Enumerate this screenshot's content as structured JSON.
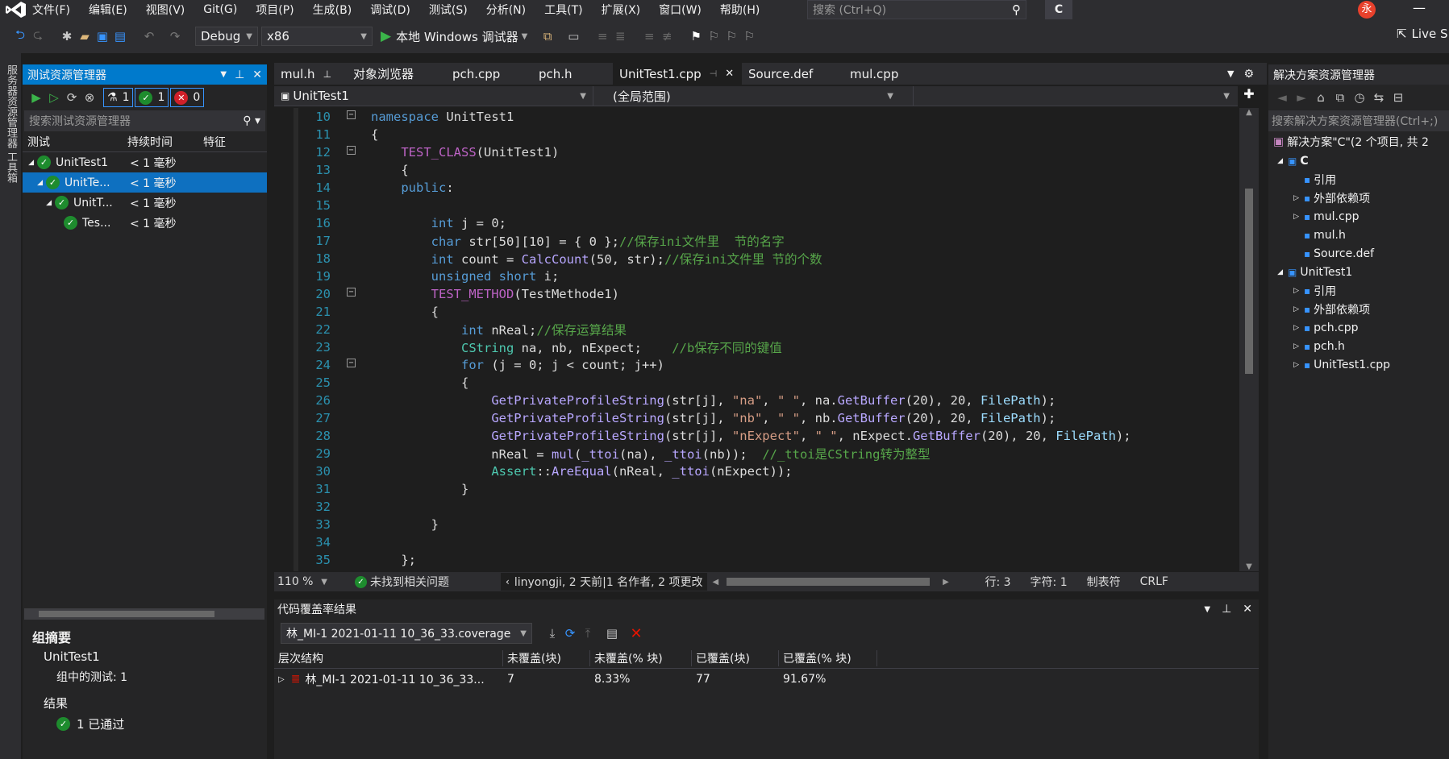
{
  "menu": [
    "文件(F)",
    "编辑(E)",
    "视图(V)",
    "Git(G)",
    "项目(P)",
    "生成(B)",
    "调试(D)",
    "测试(S)",
    "分析(N)",
    "工具(T)",
    "扩展(X)",
    "窗口(W)",
    "帮助(H)"
  ],
  "search_placeholder": "搜索 (Ctrl+Q)",
  "solution_short": "C",
  "user_initial": "永",
  "toolbar": {
    "config": "Debug",
    "platform": "x86",
    "run_label": "本地 Windows 调试器",
    "live_share": "Live S"
  },
  "side_strip": "服务器资源管理器  工具箱",
  "test_explorer": {
    "title": "测试资源管理器",
    "count_total": "1",
    "count_passed": "1",
    "count_failed": "0",
    "search_placeholder": "搜索测试资源管理器",
    "columns": [
      "测试",
      "持续时间",
      "特征"
    ],
    "rows": [
      {
        "name": "UnitTest1",
        "duration": "< 1 毫秒",
        "indent": 0
      },
      {
        "name": "UnitTe...",
        "duration": "< 1 毫秒",
        "indent": 1
      },
      {
        "name": "UnitT...",
        "duration": "< 1 毫秒",
        "indent": 2
      },
      {
        "name": "Tes...",
        "duration": "< 1 毫秒",
        "indent": 3
      }
    ],
    "summary_title": "组摘要",
    "summary_group": "UnitTest1",
    "summary_tests": "组中的测试: 1",
    "result_label": "结果",
    "result_value": "1 已通过"
  },
  "tabs": [
    {
      "label": "mul.h",
      "pinned": true
    },
    {
      "label": "对象浏览器"
    },
    {
      "label": "pch.cpp"
    },
    {
      "label": "pch.h"
    },
    {
      "label": "UnitTest1.cpp",
      "active": true
    },
    {
      "label": "Source.def"
    },
    {
      "label": "mul.cpp"
    }
  ],
  "nav": {
    "scope1": "UnitTest1",
    "scope2": "(全局范围)"
  },
  "code_lines": [
    {
      "n": "10",
      "t": "namespace UnitTest1"
    },
    {
      "n": "11",
      "t": "{"
    },
    {
      "n": "12",
      "t": "    TEST_CLASS(UnitTest1)"
    },
    {
      "n": "13",
      "t": "    {"
    },
    {
      "n": "14",
      "t": "    public:"
    },
    {
      "n": "15",
      "t": ""
    },
    {
      "n": "16",
      "t": "        int j = 0;"
    },
    {
      "n": "17",
      "t": "        char str[50][10] = { 0 };//保存ini文件里  节的名字"
    },
    {
      "n": "18",
      "t": "        int count = CalcCount(50, str);//保存ini文件里 节的个数"
    },
    {
      "n": "19",
      "t": "        unsigned short i;"
    },
    {
      "n": "20",
      "t": "        TEST_METHOD(TestMethode1)"
    },
    {
      "n": "21",
      "t": "        {"
    },
    {
      "n": "22",
      "t": "            int nReal;//保存运算结果"
    },
    {
      "n": "23",
      "t": "            CString na, nb, nExpect;    //b保存不同的键值"
    },
    {
      "n": "24",
      "t": "            for (j = 0; j < count; j++)"
    },
    {
      "n": "25",
      "t": "            {"
    },
    {
      "n": "26",
      "t": "                GetPrivateProfileString(str[j], \"na\", \" \", na.GetBuffer(20), 20, FilePath);"
    },
    {
      "n": "27",
      "t": "                GetPrivateProfileString(str[j], \"nb\", \" \", nb.GetBuffer(20), 20, FilePath);"
    },
    {
      "n": "28",
      "t": "                GetPrivateProfileString(str[j], \"nExpect\", \" \", nExpect.GetBuffer(20), 20, FilePath);"
    },
    {
      "n": "29",
      "t": "                nReal = mul(_ttoi(na), _ttoi(nb));  //_ttoi是CString转为整型"
    },
    {
      "n": "30",
      "t": "                Assert::AreEqual(nReal, _ttoi(nExpect));"
    },
    {
      "n": "31",
      "t": "            }"
    },
    {
      "n": "32",
      "t": ""
    },
    {
      "n": "33",
      "t": "        }"
    },
    {
      "n": "34",
      "t": ""
    },
    {
      "n": "35",
      "t": "    };"
    }
  ],
  "status": {
    "zoom": "110 %",
    "issues": "未找到相关问题",
    "git": "linyongji, 2 天前|1 名作者, 2 项更改",
    "line": "行: 3",
    "char": "字符: 1",
    "tabs": "制表符",
    "eol": "CRLF"
  },
  "coverage": {
    "title": "代码覆盖率结果",
    "file": "林_MI-1 2021-01-11 10_36_33.coverage",
    "columns": [
      "层次结构",
      "未覆盖(块)",
      "未覆盖(% 块)",
      "已覆盖(块)",
      "已覆盖(% 块)"
    ],
    "row": {
      "name": "林_MI-1 2021-01-11 10_36_33...",
      "uncovered": "7",
      "uncovered_pct": "8.33%",
      "covered": "77",
      "covered_pct": "91.67%"
    }
  },
  "solution_explorer": {
    "title": "解决方案资源管理器",
    "search_placeholder": "搜索解决方案资源管理器(Ctrl+;)",
    "root": "解决方案\"C\"(2 个项目, 共 2",
    "items": [
      {
        "label": "C",
        "indent": 1,
        "bold": true
      },
      {
        "label": "引用",
        "indent": 2
      },
      {
        "label": "外部依赖项",
        "indent": 2
      },
      {
        "label": "mul.cpp",
        "indent": 2
      },
      {
        "label": "mul.h",
        "indent": 2
      },
      {
        "label": "Source.def",
        "indent": 2
      },
      {
        "label": "UnitTest1",
        "indent": 1
      },
      {
        "label": "引用",
        "indent": 2
      },
      {
        "label": "外部依赖项",
        "indent": 2
      },
      {
        "label": "pch.cpp",
        "indent": 2
      },
      {
        "label": "pch.h",
        "indent": 2
      },
      {
        "label": "UnitTest1.cpp",
        "indent": 2
      }
    ]
  },
  "colors": {
    "accent": "#007acc",
    "selected_row": "#0e70c0",
    "pass": "#1e8c2e",
    "fail": "#d0202a",
    "logo": "#68217a"
  }
}
